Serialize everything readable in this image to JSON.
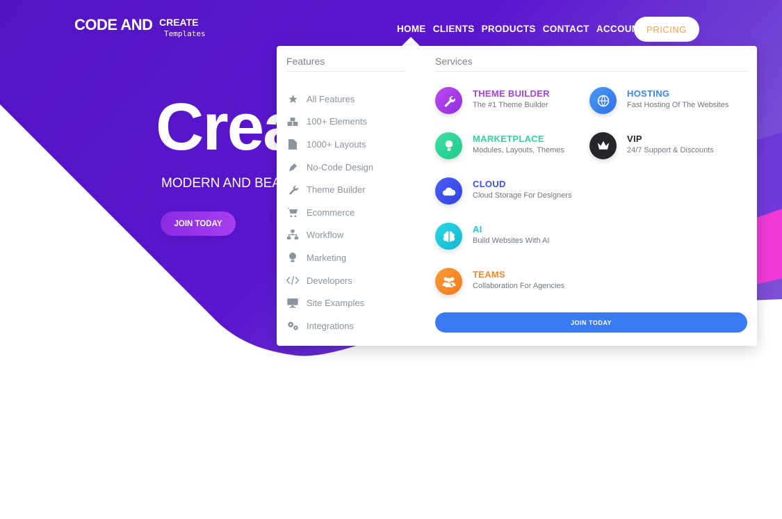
{
  "logo": {
    "main": "CODE AND",
    "create": "CREATE",
    "templates": "Templates"
  },
  "nav": {
    "items": [
      "HOME",
      "CLIENTS",
      "PRODUCTS",
      "CONTACT",
      "ACCOUNT"
    ],
    "pricing": "PRICING"
  },
  "hero": {
    "title": "Crea",
    "subtitle": "MODERN AND BEAU",
    "button": "JOIN TODAY"
  },
  "dropdown": {
    "features_heading": "Features",
    "services_heading": "Services",
    "features": [
      {
        "icon": "star-icon",
        "label": "All Features"
      },
      {
        "icon": "boxes-icon",
        "label": "100+ Elements"
      },
      {
        "icon": "file-icon",
        "label": "1000+ Layouts"
      },
      {
        "icon": "pen-icon",
        "label": "No-Code Design"
      },
      {
        "icon": "wrench-icon",
        "label": "Theme Builder"
      },
      {
        "icon": "cart-icon",
        "label": "Ecommerce"
      },
      {
        "icon": "sitemap-icon",
        "label": "Workflow"
      },
      {
        "icon": "lightbulb-icon",
        "label": "Marketing"
      },
      {
        "icon": "code-icon",
        "label": "Developers"
      },
      {
        "icon": "monitor-icon",
        "label": "Site Examples"
      },
      {
        "icon": "cogs-icon",
        "label": "Integrations"
      }
    ],
    "services": [
      {
        "title": "THEME BUILDER",
        "desc": "The #1 Theme Builder",
        "color": "#a83ee8",
        "icon": "wrench-icon"
      },
      {
        "title": "HOSTING",
        "desc": "Fast Hosting Of The Websites",
        "color": "#3a86f0",
        "icon": "globe-icon"
      },
      {
        "title": "MARKETPLACE",
        "desc": "Modules, Layouts, Themes",
        "color": "#2fd69a",
        "icon": "lightbulb-icon"
      },
      {
        "title": "VIP",
        "desc": "24/7 Support & Discounts",
        "color": "#24262b",
        "icon": "crown-icon"
      },
      {
        "title": "CLOUD",
        "desc": "Cloud Storage For Designers",
        "color": "#3d4ff0",
        "icon": "cloud-icon"
      },
      {
        "title": "AI",
        "desc": "Build Websites With AI",
        "color": "#1fc8dc",
        "icon": "brain-icon"
      },
      {
        "title": "TEAMS",
        "desc": "Collaboration For Agencies",
        "color": "#f7892a",
        "icon": "users-icon"
      }
    ],
    "join_button": "JOIN TODAY"
  }
}
